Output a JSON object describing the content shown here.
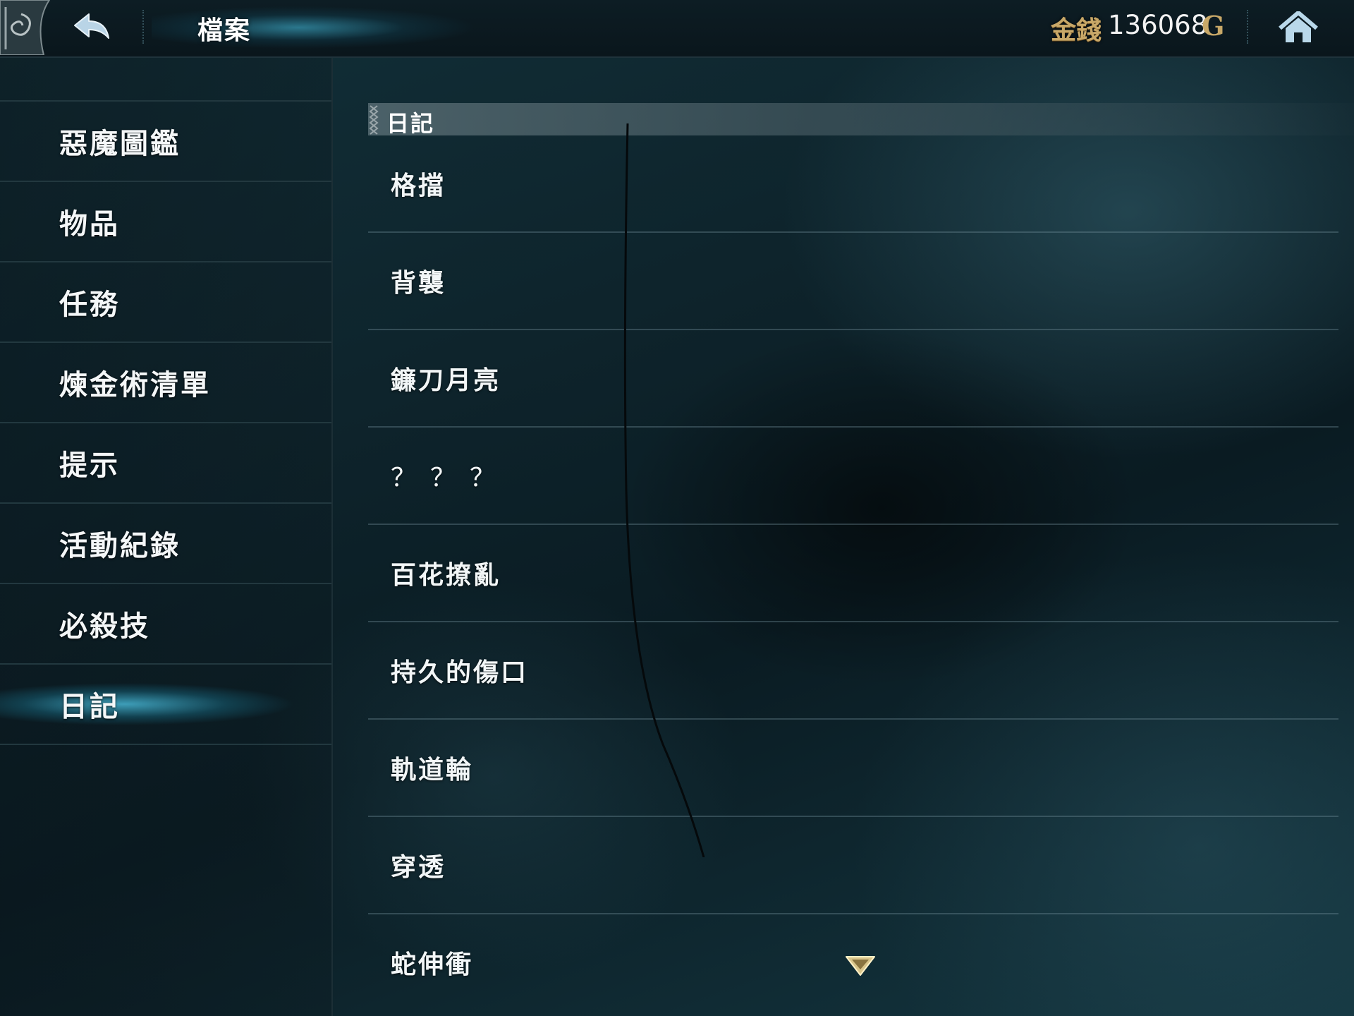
{
  "header": {
    "title": "檔案",
    "money_label": "金錢",
    "money_value": "136068",
    "money_unit": "G",
    "back_icon": "back-arrow-icon",
    "home_icon": "home-icon"
  },
  "sidebar": {
    "items": [
      {
        "label": "惡魔圖鑑",
        "active": false
      },
      {
        "label": "物品",
        "active": false
      },
      {
        "label": "任務",
        "active": false
      },
      {
        "label": "煉金術清單",
        "active": false
      },
      {
        "label": "提示",
        "active": false
      },
      {
        "label": "活動紀錄",
        "active": false
      },
      {
        "label": "必殺技",
        "active": false
      },
      {
        "label": "日記",
        "active": true
      }
    ]
  },
  "main": {
    "section_title": "日記",
    "entries": [
      {
        "label": "格擋"
      },
      {
        "label": "背襲"
      },
      {
        "label": "鐮刀月亮"
      },
      {
        "label": "？？？"
      },
      {
        "label": "百花撩亂"
      },
      {
        "label": "持久的傷口"
      },
      {
        "label": "軌道輪"
      },
      {
        "label": "穿透"
      },
      {
        "label": "蛇伸衝"
      }
    ],
    "scroll_icon": "scroll-down-arrow-icon"
  },
  "colors": {
    "accent_glow": "#46b4d2",
    "gold": "#c8a868",
    "background": "#0e242c"
  }
}
